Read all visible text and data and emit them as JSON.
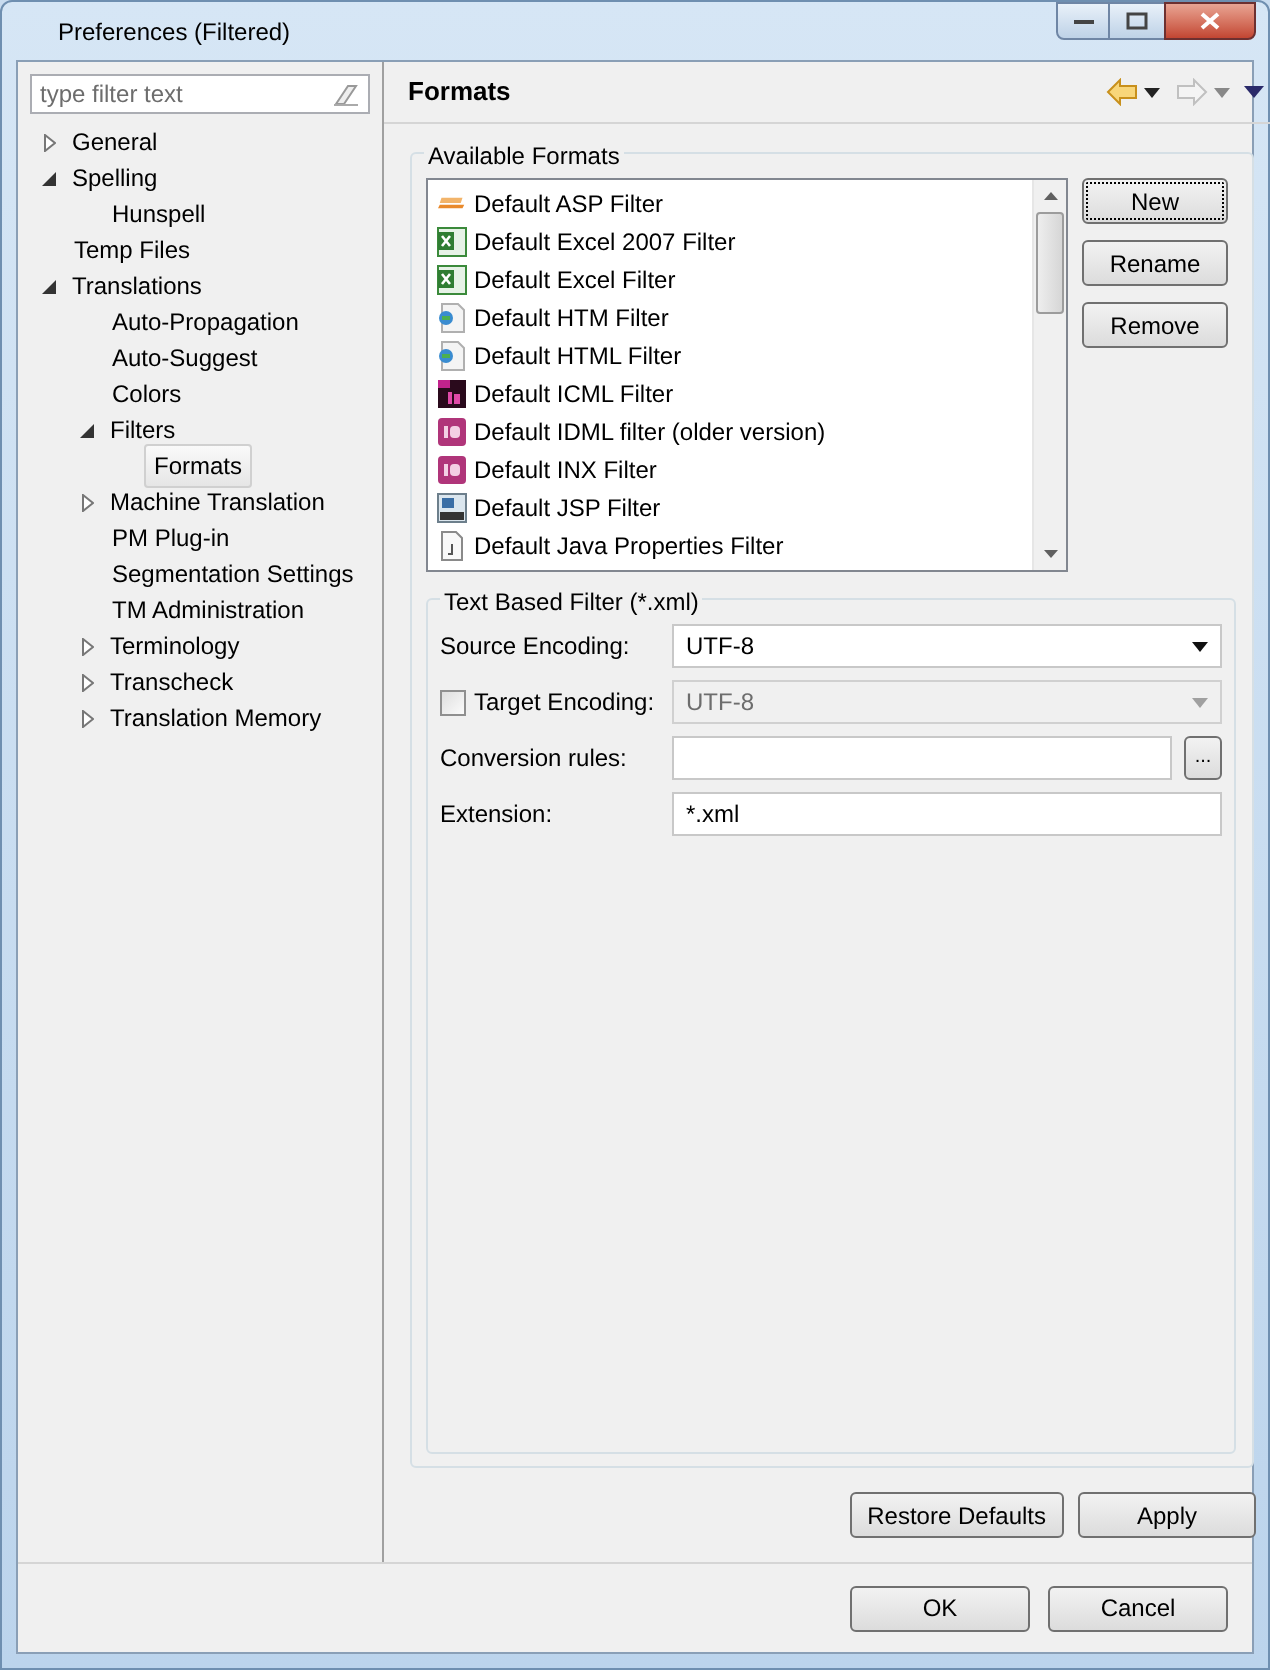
{
  "window": {
    "title": "Preferences (Filtered)"
  },
  "filter": {
    "placeholder": "type filter text"
  },
  "tree": [
    {
      "label": "General",
      "expanded": false,
      "selected": false
    },
    {
      "label": "Spelling",
      "expanded": true,
      "selected": false,
      "children": [
        {
          "label": "Hunspell",
          "selected": false
        }
      ]
    },
    {
      "label": "Temp Files",
      "selected": false
    },
    {
      "label": "Translations",
      "expanded": true,
      "selected": false,
      "children": [
        {
          "label": "Auto-Propagation",
          "selected": false
        },
        {
          "label": "Auto-Suggest",
          "selected": false
        },
        {
          "label": "Colors",
          "selected": false
        },
        {
          "label": "Filters",
          "expanded": true,
          "selected": false,
          "children": [
            {
              "label": "Formats",
              "selected": true
            }
          ]
        },
        {
          "label": "Machine Translation",
          "expanded": false,
          "selected": false
        },
        {
          "label": "PM Plug-in",
          "selected": false
        },
        {
          "label": "Segmentation Settings",
          "selected": false
        },
        {
          "label": "TM Administration",
          "selected": false
        },
        {
          "label": "Terminology",
          "expanded": false,
          "selected": false
        },
        {
          "label": "Transcheck",
          "expanded": false,
          "selected": false
        },
        {
          "label": "Translation Memory",
          "expanded": false,
          "selected": false
        }
      ]
    }
  ],
  "page": {
    "title": "Formats"
  },
  "formats": {
    "title": "Available Formats",
    "items": [
      {
        "label": "Default ASP Filter",
        "kind": "asp"
      },
      {
        "label": "Default Excel 2007 Filter",
        "kind": "sheet"
      },
      {
        "label": "Default Excel Filter",
        "kind": "sheet"
      },
      {
        "label": "Default HTM Filter",
        "kind": "web"
      },
      {
        "label": "Default HTML Filter",
        "kind": "web"
      },
      {
        "label": "Default ICML Filter",
        "kind": "icml"
      },
      {
        "label": "Default IDML filter (older version)",
        "kind": "indesign"
      },
      {
        "label": "Default INX Filter",
        "kind": "indesign"
      },
      {
        "label": "Default JSP Filter",
        "kind": "jsp"
      },
      {
        "label": "Default Java Properties Filter",
        "kind": "java"
      }
    ],
    "buttons": [
      {
        "label": "New",
        "focused": true
      },
      {
        "label": "Rename",
        "focused": false
      },
      {
        "label": "Remove",
        "focused": false
      }
    ]
  },
  "filter_settings": {
    "title": "Text Based Filter (*.xml)",
    "rows": [
      {
        "kind": "select",
        "label": "Source Encoding:",
        "value": "UTF-8",
        "disabled": false
      },
      {
        "kind": "checkselect",
        "label": "Target Encoding:",
        "checked": false,
        "value": "UTF-8",
        "disabled": true
      },
      {
        "kind": "browse",
        "label": "Conversion rules:",
        "button": "..."
      },
      {
        "kind": "text",
        "label": "Extension:",
        "value": "*.xml"
      }
    ]
  },
  "page_buttons": [
    "Restore Defaults",
    "Apply"
  ],
  "dialog_buttons": [
    "OK",
    "Cancel"
  ]
}
